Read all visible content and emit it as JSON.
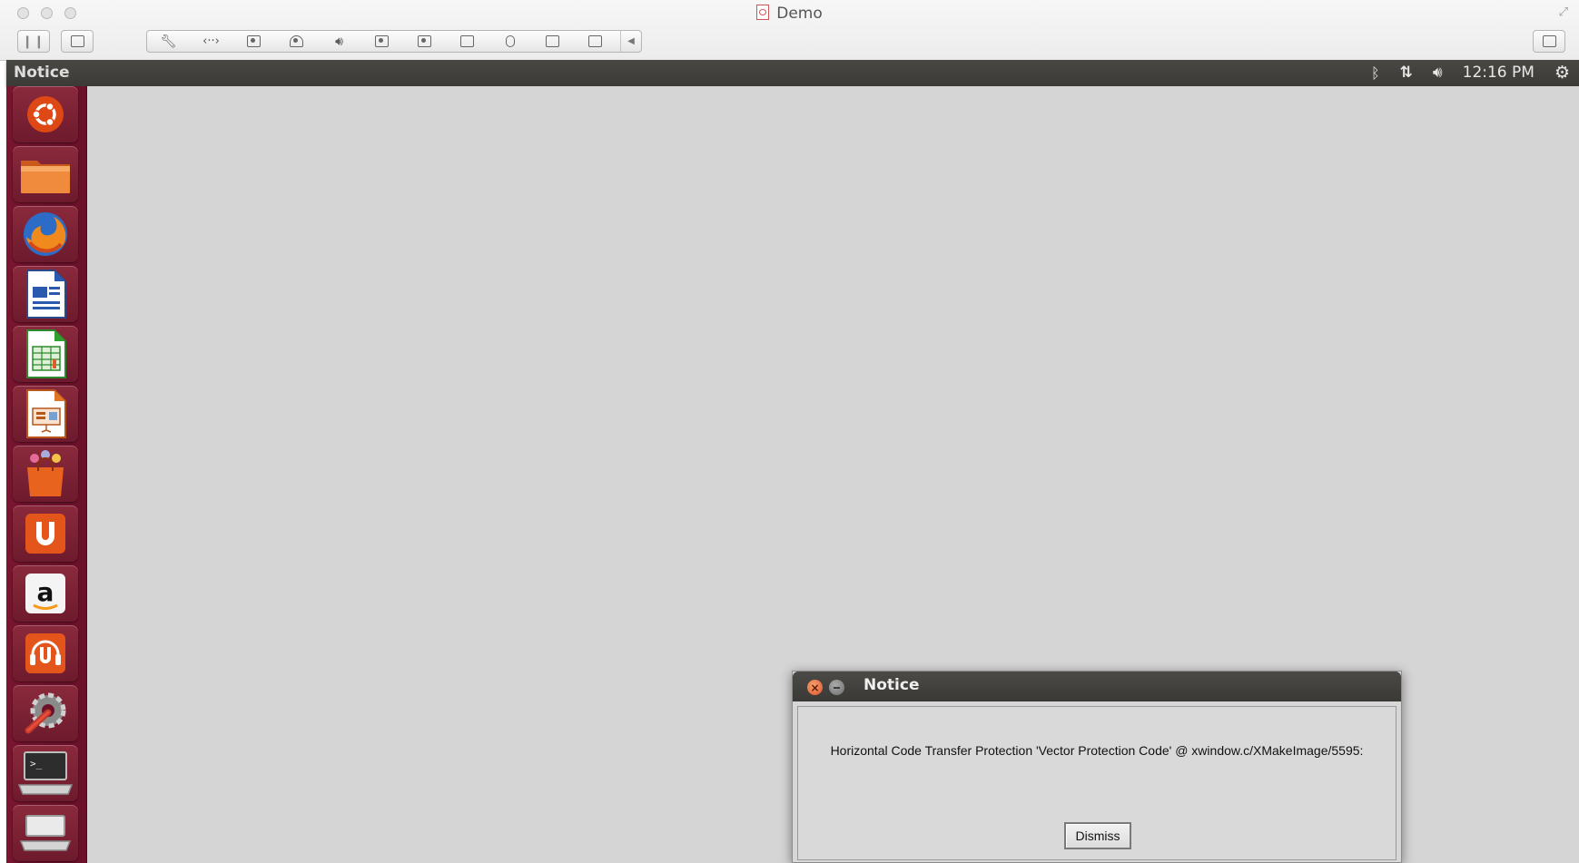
{
  "host": {
    "window_title": "Demo",
    "controls": [
      "close",
      "minimize",
      "zoom"
    ],
    "left_buttons": [
      {
        "icon": "pause-icon"
      },
      {
        "icon": "snapshot-icon"
      }
    ],
    "toolbar_icons": [
      "wrench-icon",
      "resize-arrows-icon",
      "disk-icon",
      "hard-drive-icon",
      "volume-icon",
      "camera-icon",
      "camera-icon",
      "network-icon",
      "mouse-icon",
      "usb-icon",
      "sync-icon"
    ],
    "right_button": {
      "icon": "restore-window-icon"
    }
  },
  "panel": {
    "app_title": "Notice",
    "indicators": {
      "bluetooth": "bluetooth-icon",
      "network": "network-transfer-icon",
      "volume": "volume-icon",
      "clock": "12:16 PM",
      "system": "gear-icon"
    }
  },
  "launcher": {
    "items": [
      {
        "name": "dash-home",
        "icon": "ubuntu-logo-icon"
      },
      {
        "name": "files",
        "icon": "folder-icon"
      },
      {
        "name": "firefox",
        "icon": "firefox-icon"
      },
      {
        "name": "writer",
        "icon": "document-icon"
      },
      {
        "name": "calc",
        "icon": "spreadsheet-icon"
      },
      {
        "name": "impress",
        "icon": "presentation-icon"
      },
      {
        "name": "software-center",
        "icon": "shopping-bag-icon"
      },
      {
        "name": "ubuntu-one",
        "icon": "ubuntu-one-icon"
      },
      {
        "name": "amazon",
        "icon": "amazon-icon"
      },
      {
        "name": "ubuntu-one-music",
        "icon": "music-icon"
      },
      {
        "name": "system-settings",
        "icon": "settings-icon"
      },
      {
        "name": "terminal",
        "icon": "terminal-icon"
      },
      {
        "name": "workspace",
        "icon": "workspace-icon"
      }
    ]
  },
  "dialog": {
    "title": "Notice",
    "message": "Horizontal Code Transfer Protection 'Vector Protection Code' @ xwindow.c/XMakeImage/5595:",
    "dismiss_label": "Dismiss"
  },
  "colors": {
    "launcher": "#6b1129",
    "panel": "#3b3a36",
    "desktop": "#d5d5d5",
    "close_button": "#e0552b"
  }
}
